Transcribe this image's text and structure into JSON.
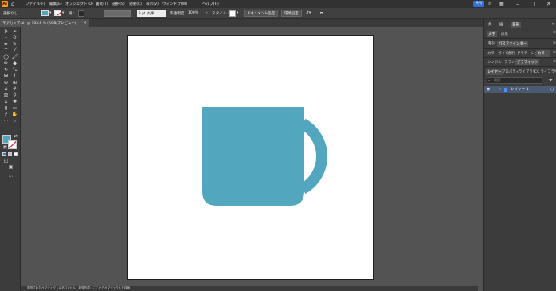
{
  "menubar": {
    "items": [
      "ファイル(F)",
      "編集(E)",
      "オブジェクト(O)",
      "書式(T)",
      "選択(S)",
      "効果(C)",
      "表示(V)",
      "ウィンドウ(W)",
      "ヘルプ(H)"
    ],
    "share_label": "共有"
  },
  "controlbar": {
    "selection_label": "選択なし",
    "stroke_label": "線 :",
    "brush_label": "3 pt. 丸筆",
    "opacity_label": "不透明度 :",
    "opacity_value": "100%",
    "style_label": "スタイル :",
    "doc_setup_label": "ドキュメント設定",
    "prefs_label": "環境設定"
  },
  "document": {
    "tab_title": "マグカップ.ai* @ 163.8 % (RGB/プレビュー)",
    "close_glyph": "×"
  },
  "colors": {
    "fill": "#52a7bf",
    "mug": "#52a7bf"
  },
  "right_panel": {
    "top_tabs": [
      "色",
      "線",
      "変形"
    ],
    "row2_tabs": [
      "文字",
      "段落"
    ],
    "row3_tabs": [
      "整列",
      "パスファインダー"
    ],
    "row4_tabs": [
      "カラーガイド",
      "透明",
      "グラデーション",
      "カラー"
    ],
    "row5_tabs": [
      "シンボル",
      "ブラシ",
      "グラフィック"
    ],
    "layers_tabs": [
      "レイヤー",
      "プロパティ",
      "ライブラリ",
      "CC ライブラリ"
    ],
    "search_placeholder": "検索",
    "layer_name": "レイヤー 1"
  },
  "statusbar": {
    "text": "選択されたオブジェクトはありません　新規作成：ここからオブジェクトを描画"
  },
  "icons": [
    "home-icon",
    "search-icon",
    "arrange-icon",
    "minimize-icon",
    "maximize-icon",
    "close-icon",
    "eye-icon",
    "filter-icon",
    "mug-artwork"
  ]
}
